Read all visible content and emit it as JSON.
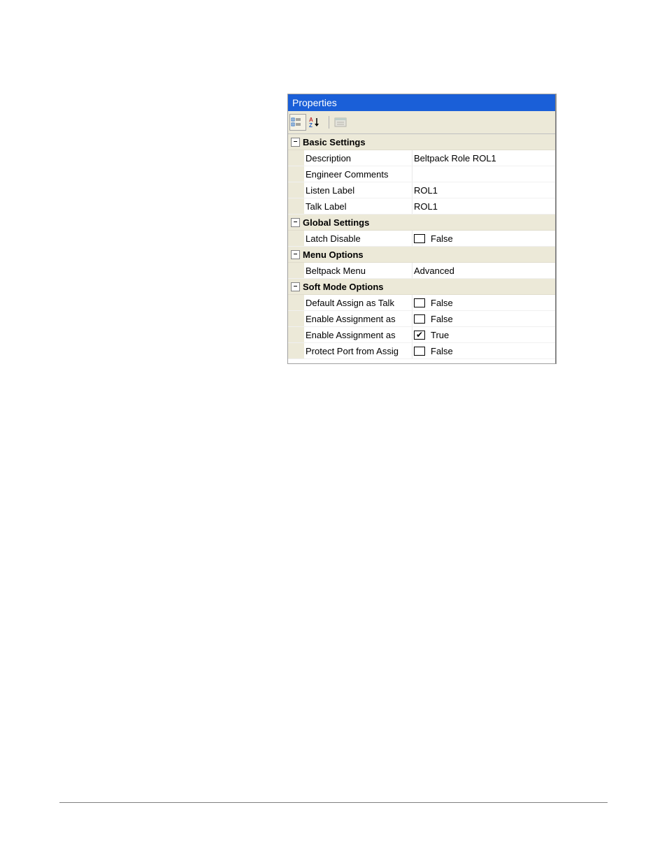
{
  "panel": {
    "title": "Properties",
    "categories": [
      {
        "name": "Basic Settings",
        "rows": [
          {
            "label": "Description",
            "value": "Beltpack Role ROL1",
            "checkbox": null
          },
          {
            "label": "Engineer Comments",
            "value": "",
            "checkbox": null
          },
          {
            "label": "Listen Label",
            "value": "ROL1",
            "checkbox": null
          },
          {
            "label": "Talk Label",
            "value": "ROL1",
            "checkbox": null
          }
        ]
      },
      {
        "name": "Global Settings",
        "rows": [
          {
            "label": "Latch Disable",
            "value": "False",
            "checkbox": false
          }
        ]
      },
      {
        "name": "Menu Options",
        "rows": [
          {
            "label": "Beltpack Menu",
            "value": "Advanced",
            "checkbox": null
          }
        ]
      },
      {
        "name": "Soft Mode Options",
        "rows": [
          {
            "label": "Default Assign as Talk",
            "value": "False",
            "checkbox": false
          },
          {
            "label": "Enable Assignment as",
            "value": "False",
            "checkbox": false
          },
          {
            "label": "Enable Assignment as",
            "value": "True",
            "checkbox": true
          },
          {
            "label": "Protect Port from Assig",
            "value": "False",
            "checkbox": false
          }
        ]
      }
    ]
  },
  "expander_glyph": "⊟"
}
